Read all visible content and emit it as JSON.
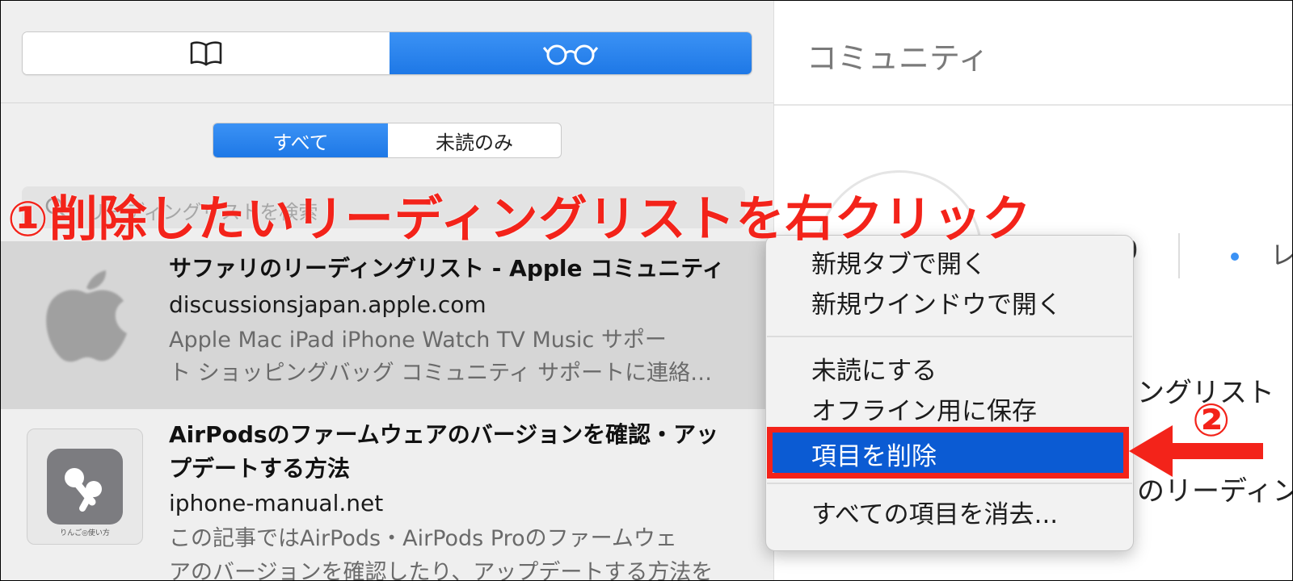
{
  "sidebar": {
    "tabs": {
      "bookmarks_icon": "book-icon",
      "reading_list_icon": "glasses-icon",
      "active_color": "#1e78e6"
    },
    "filter": {
      "all_label": "すべて",
      "unread_label": "未読のみ",
      "selected": "すべて"
    },
    "search": {
      "placeholder": "リーディングリストを検索"
    },
    "items": [
      {
        "title": "サファリのリーディングリスト - Apple コミュニティ",
        "site": "discussionsjapan.apple.com",
        "desc1": "Apple Mac iPad iPhone Watch TV Music サポー",
        "desc2": "ト ショッピングバッグ コミュニティ サポートに連絡…",
        "thumb": "apple-logo"
      },
      {
        "title1": "AirPodsのファームウェアのバージョンを確認・アッ",
        "title2": "プデートする方法",
        "site": "iphone-manual.net",
        "desc1": "この記事ではAirPods・AirPods Proのファームウェ",
        "desc2": "アのバージョンを確認したり、アップデートする方法を",
        "thumb_caption": "りんご◎使い方"
      }
    ]
  },
  "content": {
    "title": "コミュニティ",
    "frag1": "0",
    "frag2": "レ",
    "frag3": "ィングリスト",
    "frag4": "リのリーディン"
  },
  "context_menu": {
    "items": [
      "新規タブで開く",
      "新規ウインドウで開く",
      "未読にする",
      "オフライン用に保存",
      "項目を削除",
      "すべての項目を消去..."
    ],
    "highlighted": "項目を削除",
    "highlight_color": "#0b5bd3"
  },
  "annotations": {
    "step1": "①削除したいリーディングリストを右クリック",
    "step2": "②",
    "color": "#f3231a"
  }
}
